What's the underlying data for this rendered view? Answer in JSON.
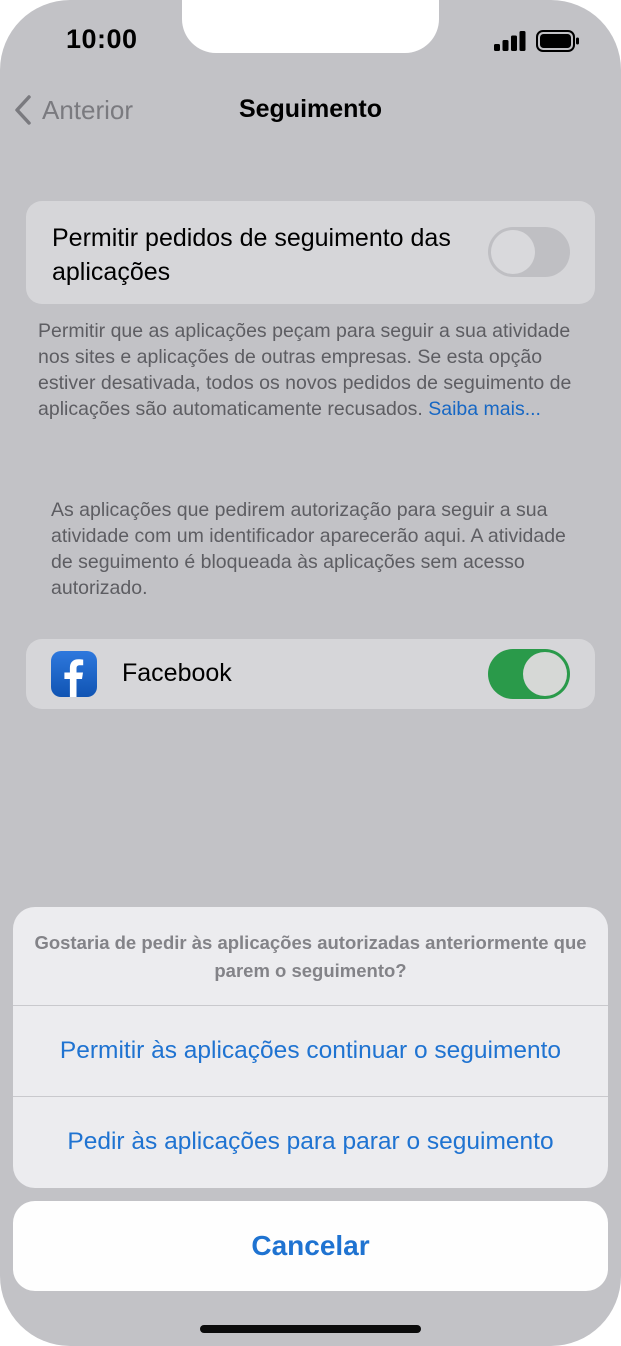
{
  "status_bar": {
    "time": "10:00"
  },
  "nav": {
    "back_label": "Anterior",
    "title": "Seguimento"
  },
  "tracking_toggle": {
    "label": "Permitir pedidos de seguimento das aplicações",
    "enabled": false
  },
  "description": {
    "text": "Permitir que as aplicações peçam para seguir a sua atividade nos sites e aplicações de outras empresas. Se esta opção estiver desativada, todos os novos pedidos de seguimento de aplicações são automaticamente recusados.",
    "link": "Saiba mais..."
  },
  "info": {
    "text": "As aplicações que pedirem autorização para seguir a sua atividade com um identificador aparecerão aqui. A atividade de seguimento é bloqueada às aplicações sem acesso autorizado."
  },
  "apps": [
    {
      "name": "Facebook",
      "icon": "facebook-icon",
      "enabled": true
    }
  ],
  "action_sheet": {
    "message": "Gostaria de pedir às aplicações autorizadas anteriormente que parem o seguimento?",
    "allow_label": "Permitir às aplicações continuar o seguimento",
    "ask_stop_label": "Pedir às aplicações para parar o seguimento",
    "cancel_label": "Cancelar"
  },
  "colors": {
    "accent": "#1f73d1",
    "toggle_on": "#2a9a4a",
    "backdrop": "#c2c2c6"
  }
}
